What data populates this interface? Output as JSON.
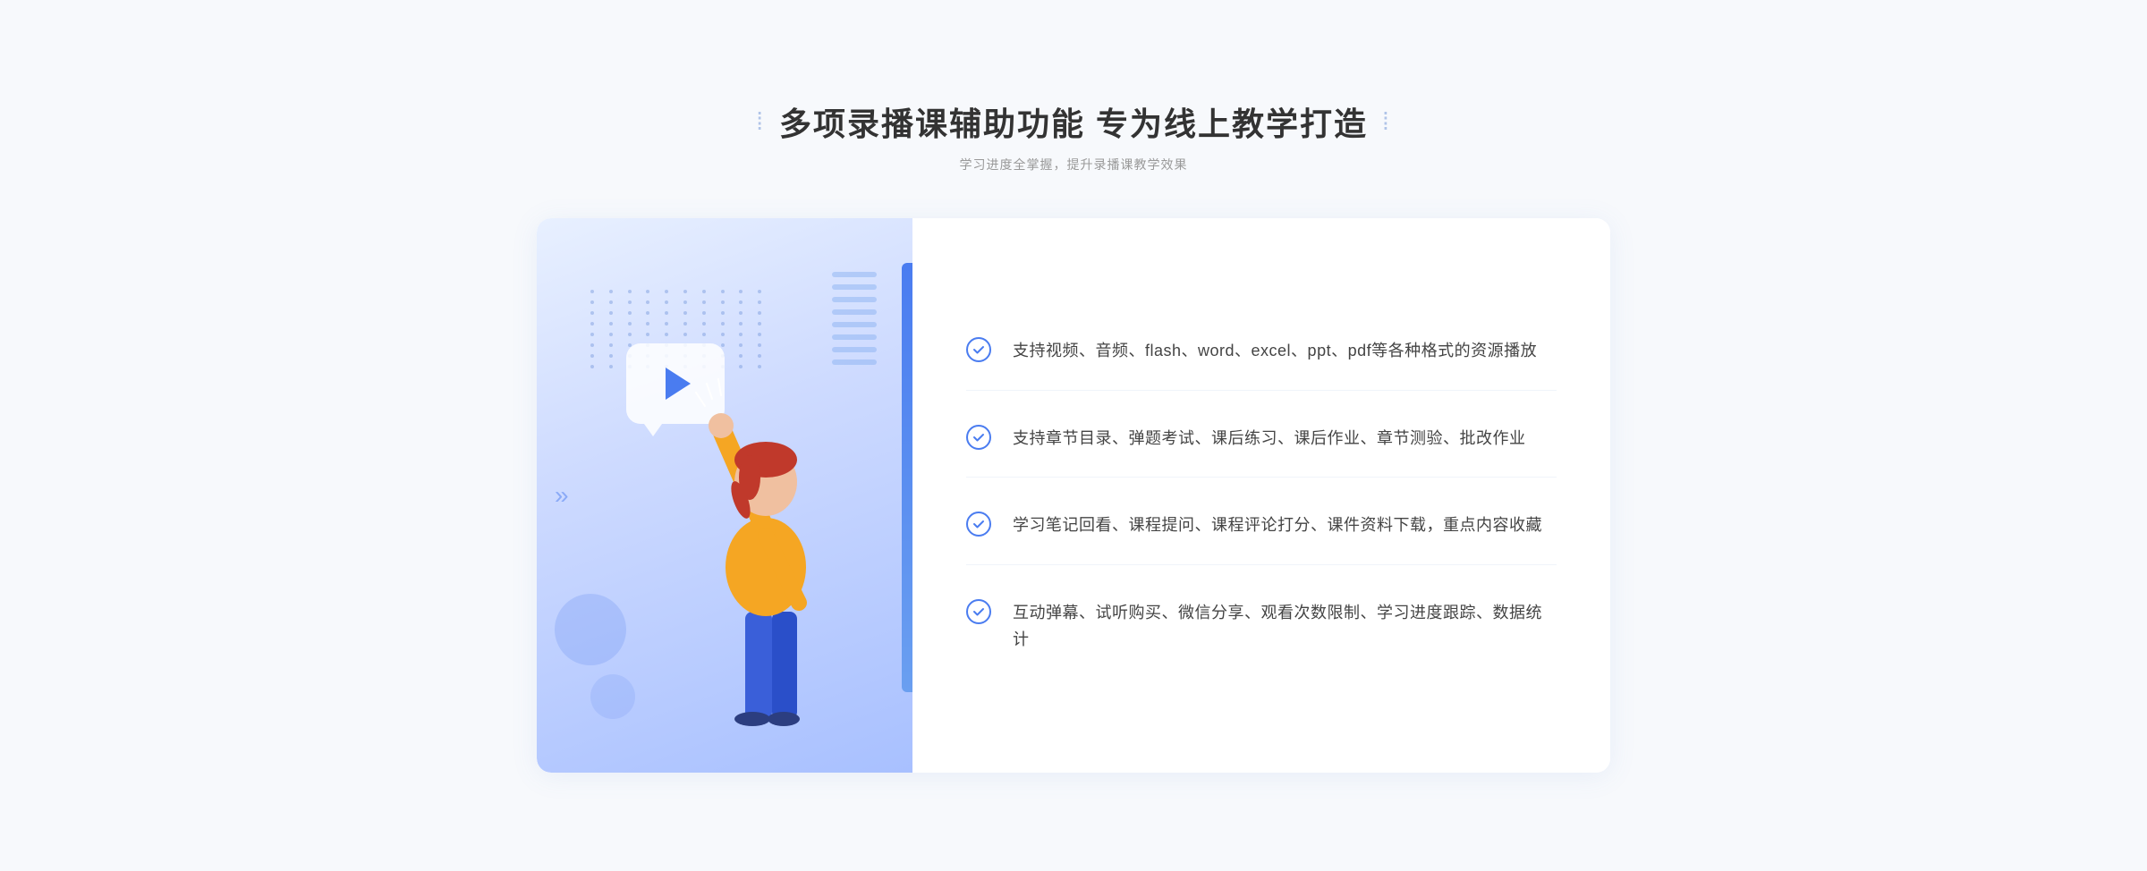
{
  "header": {
    "title": "多项录播课辅助功能 专为线上教学打造",
    "subtitle": "学习进度全掌握，提升录播课教学效果"
  },
  "features": [
    {
      "id": "feature-1",
      "text": "支持视频、音频、flash、word、excel、ppt、pdf等各种格式的资源播放"
    },
    {
      "id": "feature-2",
      "text": "支持章节目录、弹题考试、课后练习、课后作业、章节测验、批改作业"
    },
    {
      "id": "feature-3",
      "text": "学习笔记回看、课程提问、课程评论打分、课件资料下载，重点内容收藏"
    },
    {
      "id": "feature-4",
      "text": "互动弹幕、试听购买、微信分享、观看次数限制、学习进度跟踪、数据统计"
    }
  ],
  "icons": {
    "check": "✓",
    "play": "▶",
    "arrow_left": "»"
  }
}
